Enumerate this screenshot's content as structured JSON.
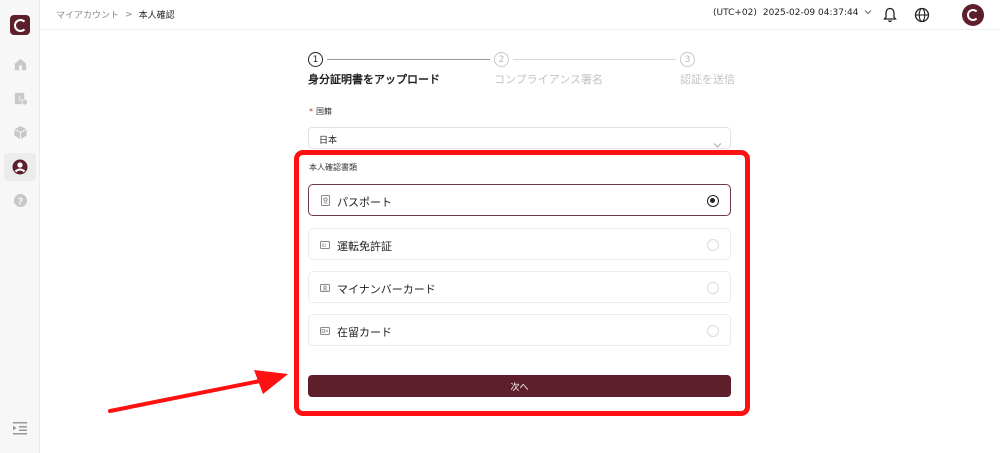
{
  "header": {
    "breadcrumb": {
      "parent": "マイアカウント",
      "separator": ">",
      "current": "本人確認"
    },
    "timezone": "(UTC+02)",
    "datetime": "2025-02-09 04:37:44",
    "icons": [
      "chevron-down-icon",
      "bell-icon",
      "globe-icon"
    ]
  },
  "sidebar": {
    "items": [
      {
        "name": "home",
        "icon": "home-icon"
      },
      {
        "name": "assets",
        "icon": "assets-icon"
      },
      {
        "name": "products",
        "icon": "cube-icon"
      },
      {
        "name": "account",
        "icon": "user-icon",
        "active": true
      },
      {
        "name": "help",
        "icon": "help-icon"
      }
    ],
    "collapse_icon": "collapse-menu-icon"
  },
  "stepper": {
    "steps": [
      {
        "number": "1",
        "label": "身分証明書をアップロード",
        "active": true
      },
      {
        "number": "2",
        "label": "コンプライアンス署名",
        "active": false
      },
      {
        "number": "3",
        "label": "認証を送信",
        "active": false
      }
    ]
  },
  "form": {
    "nationality": {
      "required_mark": "*",
      "label": "国籍",
      "value": "日本"
    },
    "document_type": {
      "label": "本人確認書類",
      "options": [
        {
          "label": "パスポート",
          "selected": true
        },
        {
          "label": "運転免許証",
          "selected": false
        },
        {
          "label": "マイナンバーカード",
          "selected": false
        },
        {
          "label": "在留カード",
          "selected": false
        }
      ]
    },
    "next_label": "次へ"
  },
  "colors": {
    "brand": "#5e1f2c",
    "annotation": "#ff1111"
  }
}
